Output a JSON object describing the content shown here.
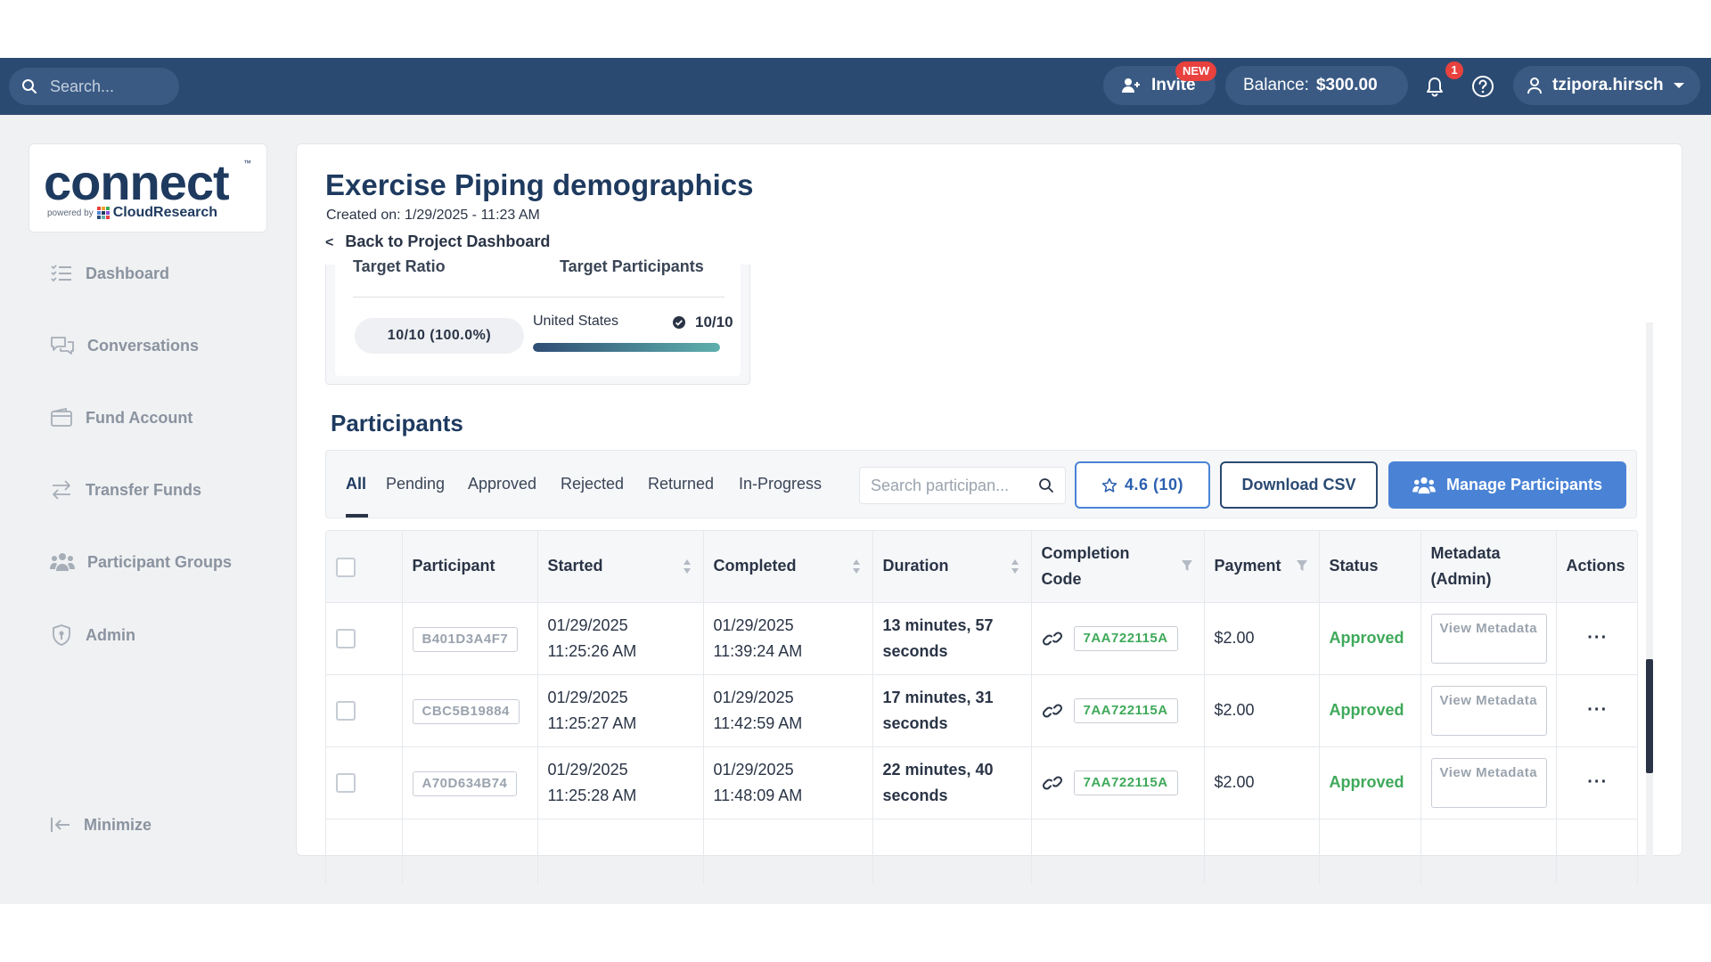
{
  "topbar": {
    "search_placeholder": "Search...",
    "invite_label": "Invite",
    "new_badge": "NEW",
    "balance_label": "Balance:",
    "balance_value": "$300.00",
    "notification_count": "1",
    "username": "tzipora.hirsch"
  },
  "logo": {
    "name": "connect",
    "trademark": "™",
    "powered_by": "powered by",
    "brand": "CloudResearch"
  },
  "sidebar": {
    "items": [
      {
        "label": "Dashboard",
        "icon": "list-icon"
      },
      {
        "label": "Conversations",
        "icon": "chat-icon"
      },
      {
        "label": "Fund Account",
        "icon": "wallet-icon"
      },
      {
        "label": "Transfer Funds",
        "icon": "transfer-icon"
      },
      {
        "label": "Participant Groups",
        "icon": "group-icon"
      },
      {
        "label": "Admin",
        "icon": "shield-icon"
      }
    ],
    "minimize_label": "Minimize"
  },
  "project": {
    "title": "Exercise Piping demographics",
    "created": "Created on: 1/29/2025 - 11:23 AM",
    "back_label": "Back to Project Dashboard",
    "back_glyph": "<"
  },
  "target": {
    "ratio_header": "Target Ratio",
    "participants_header": "Target Participants",
    "ratio_value": "10/10 (100.0%)",
    "country": "United States",
    "country_count": "10/10",
    "progress_fraction": 1.0
  },
  "participants": {
    "section_title": "Participants",
    "tabs": [
      "All",
      "Pending",
      "Approved",
      "Rejected",
      "Returned",
      "In-Progress"
    ],
    "active_tab": "All",
    "search_placeholder": "Search participan...",
    "rating_label": "4.6 (10)",
    "download_label": "Download CSV",
    "manage_label": "Manage Participants",
    "columns": [
      "Participant",
      "Started",
      "Completed",
      "Duration",
      "Completion Code",
      "Payment",
      "Status",
      "Metadata (Admin)",
      "Actions"
    ],
    "rows": [
      {
        "id": "B401D3A4F7",
        "started_date": "01/29/2025",
        "started_time": "11:25:26 AM",
        "completed_date": "01/29/2025",
        "completed_time": "11:39:24 AM",
        "duration": "13 minutes, 57 seconds",
        "code": "7AA722115A",
        "payment": "$2.00",
        "status": "Approved",
        "metadata": "View Metadata",
        "actions": "···"
      },
      {
        "id": "CBC5B19884",
        "started_date": "01/29/2025",
        "started_time": "11:25:27 AM",
        "completed_date": "01/29/2025",
        "completed_time": "11:42:59 AM",
        "duration": "17 minutes, 31 seconds",
        "code": "7AA722115A",
        "payment": "$2.00",
        "status": "Approved",
        "metadata": "View Metadata",
        "actions": "···"
      },
      {
        "id": "A70D634B74",
        "started_date": "01/29/2025",
        "started_time": "11:25:28 AM",
        "completed_date": "01/29/2025",
        "completed_time": "11:48:09 AM",
        "duration": "22 minutes, 40 seconds",
        "code": "7AA722115A",
        "payment": "$2.00",
        "status": "Approved",
        "metadata": "View Metadata",
        "actions": "···"
      }
    ]
  },
  "colors": {
    "topbar": "#2b4a72",
    "brand_navy": "#1e3a5f",
    "accent_blue": "#4a83d6",
    "approved_green": "#3fa95a",
    "alert_red": "#e8413e"
  }
}
